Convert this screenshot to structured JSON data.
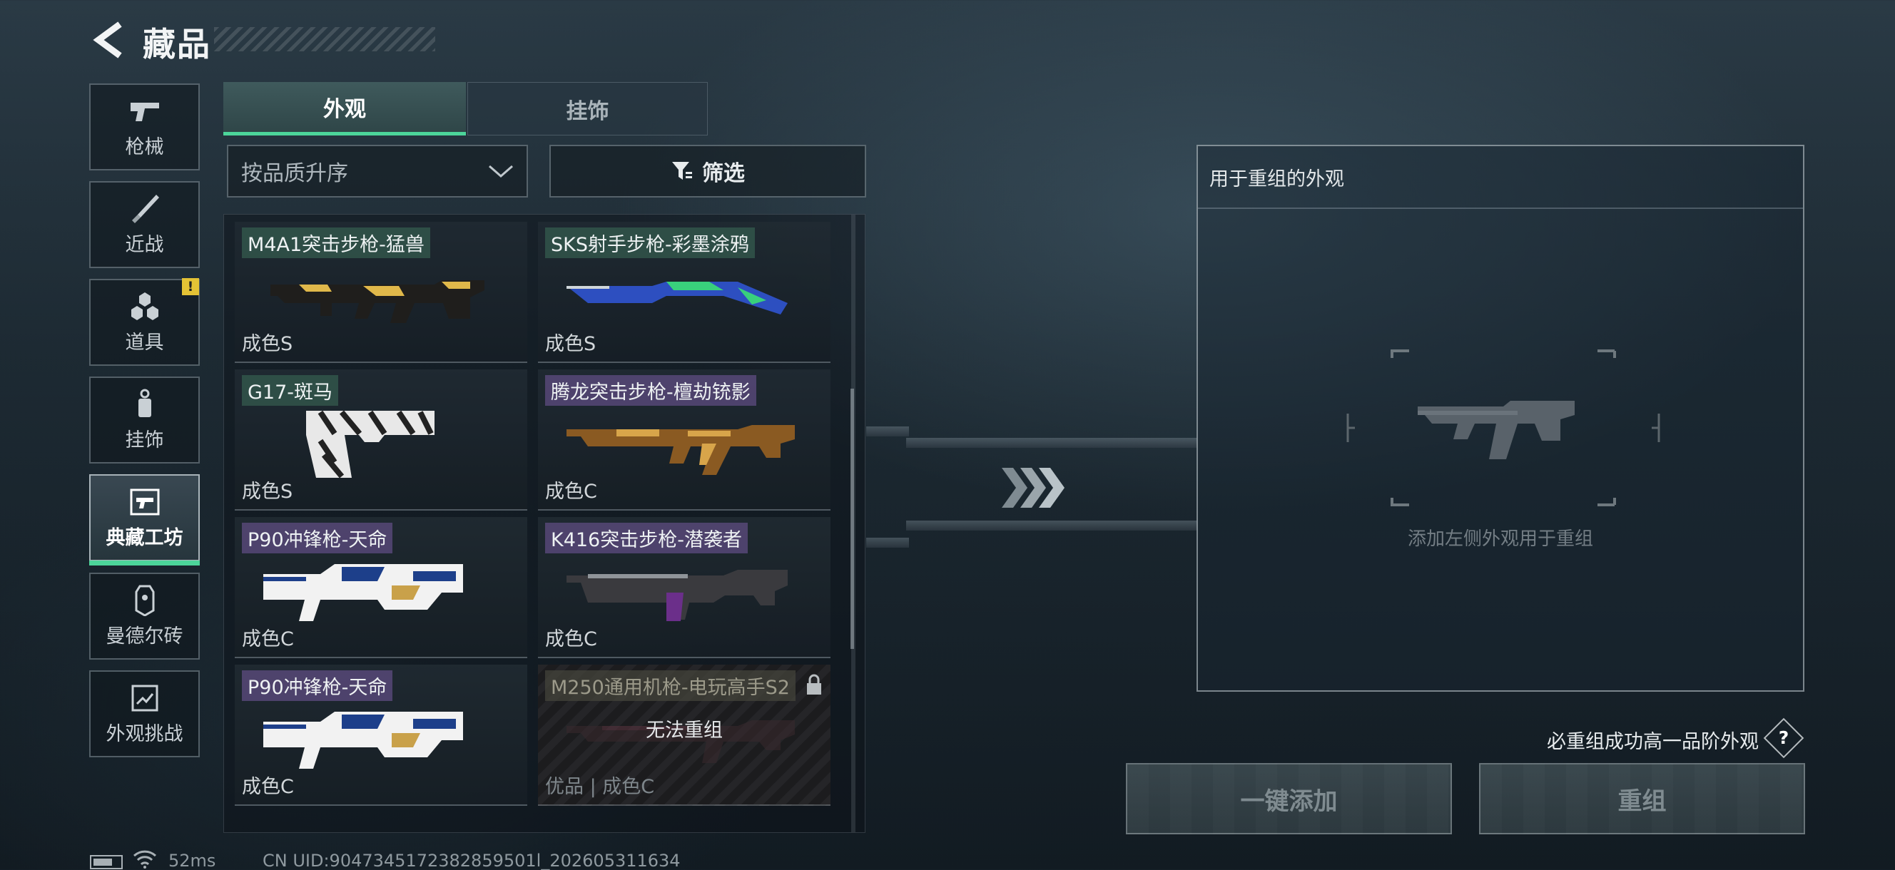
{
  "header": {
    "title": "藏品"
  },
  "nav": [
    {
      "label": "枪械",
      "icon": "pistol-icon"
    },
    {
      "label": "近战",
      "icon": "knife-icon"
    },
    {
      "label": "道具",
      "icon": "grenades-icon",
      "badge": "!"
    },
    {
      "label": "挂饰",
      "icon": "keychain-icon"
    },
    {
      "label": "典藏工坊",
      "icon": "workshop-icon",
      "active": true
    },
    {
      "label": "曼德尔砖",
      "icon": "brick-icon"
    },
    {
      "label": "外观挑战",
      "icon": "challenge-icon"
    }
  ],
  "tabs": [
    {
      "label": "外观",
      "active": true
    },
    {
      "label": "挂饰",
      "active": false
    }
  ],
  "sort": {
    "selected": "按品质升序"
  },
  "filter": {
    "label": "筛选"
  },
  "items": [
    {
      "name": "M4A1突击步枪-猛兽",
      "grade": "成色S",
      "tag": "green",
      "colors": [
        "#1a1a1a",
        "#e0b84a"
      ]
    },
    {
      "name": "SKS射手步枪-彩墨涂鸦",
      "grade": "成色S",
      "tag": "green",
      "colors": [
        "#2d4fc0",
        "#39d07c"
      ]
    },
    {
      "name": "G17-斑马",
      "grade": "成色S",
      "tag": "green",
      "colors": [
        "#e8e8e8",
        "#222222"
      ]
    },
    {
      "name": "腾龙突击步枪-檀劫铳影",
      "grade": "成色C",
      "tag": "purple",
      "colors": [
        "#8a5a22",
        "#d8a54a"
      ]
    },
    {
      "name": "P90冲锋枪-天命",
      "grade": "成色C",
      "tag": "purple",
      "colors": [
        "#f2f2f2",
        "#1d3f8a"
      ]
    },
    {
      "name": "K416突击步枪-潜袭者",
      "grade": "成色C",
      "tag": "purple",
      "colors": [
        "#3a3a3e",
        "#6b2f8a"
      ]
    },
    {
      "name": "P90冲锋枪-天命",
      "grade": "成色C",
      "tag": "purple",
      "colors": [
        "#f2f2f2",
        "#1d3f8a"
      ]
    },
    {
      "name": "M250通用机枪-电玩高手S2",
      "grade": "优品 | 成色C",
      "tag": "dim",
      "locked": true,
      "overlay": "无法重组",
      "colors": [
        "#3a2a2e",
        "#5a3540"
      ]
    }
  ],
  "reforge": {
    "title": "用于重组的外观",
    "placeholder": "添加左侧外观用于重组",
    "hint": "必重组成功高一品阶外观",
    "help": "?",
    "btn_add": "一键添加",
    "btn_reforge": "重组"
  },
  "footer": {
    "ping": "52ms",
    "uid": "CN UID:9047345172382859501l_202605311634"
  },
  "colors": {
    "accent": "#4cd59a",
    "badge": "#e4c235"
  }
}
